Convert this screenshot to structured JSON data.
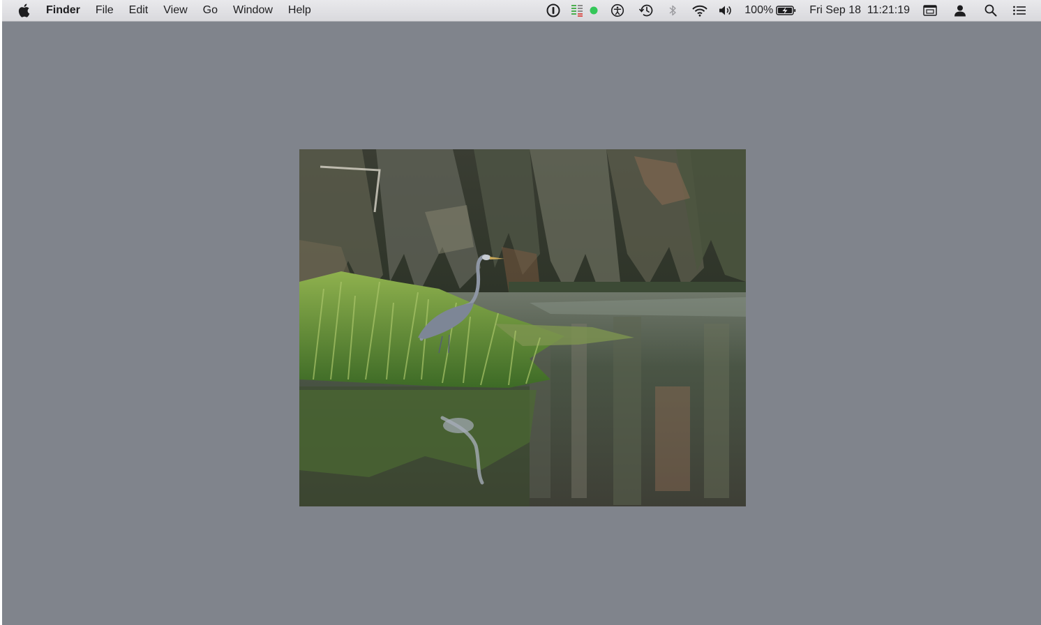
{
  "menubar": {
    "app_name": "Finder",
    "menus": [
      "File",
      "Edit",
      "View",
      "Go",
      "Window",
      "Help"
    ],
    "status": {
      "battery_percent": "100%",
      "datetime": "Fri Sep 18  11:21:19",
      "icons": [
        "onepassword-icon",
        "menu-meter-icon",
        "status-dot-icon",
        "accessibility-icon",
        "time-machine-icon",
        "bluetooth-icon",
        "wifi-icon",
        "volume-icon",
        "battery-charging-icon",
        "display-icon",
        "user-icon",
        "spotlight-search-icon",
        "notification-center-icon"
      ]
    }
  },
  "colors": {
    "desktop": "#80848c",
    "menubar": "#e3e3e6",
    "status_dot": "#34c759"
  }
}
